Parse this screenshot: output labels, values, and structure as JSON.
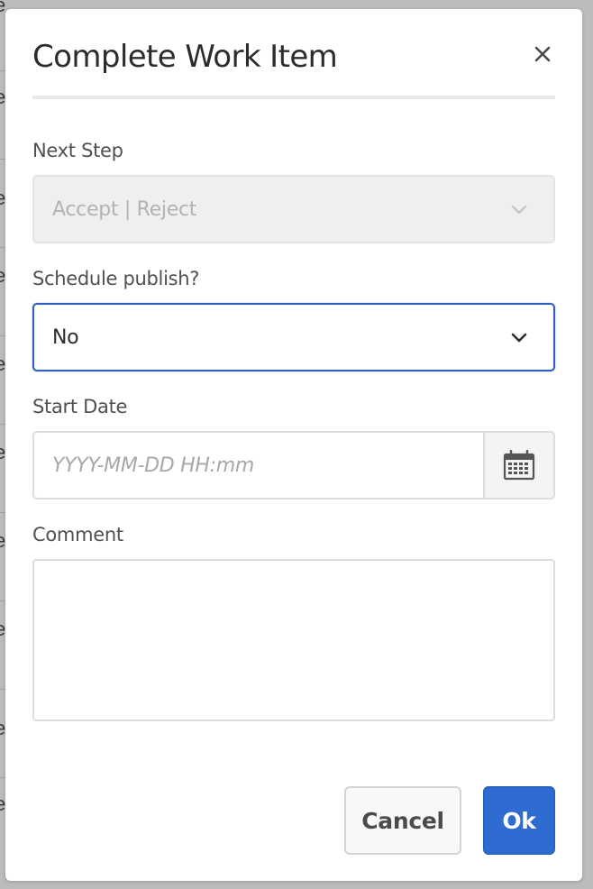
{
  "dialog": {
    "title": "Complete Work Item",
    "close_icon": "close-icon"
  },
  "fields": {
    "next_step": {
      "label": "Next Step",
      "value": "Accept | Reject",
      "disabled": true
    },
    "schedule_publish": {
      "label": "Schedule publish?",
      "value": "No"
    },
    "start_date": {
      "label": "Start Date",
      "placeholder": "YYYY-MM-DD HH:mm",
      "value": "",
      "icon": "calendar-icon"
    },
    "comment": {
      "label": "Comment",
      "value": ""
    }
  },
  "footer": {
    "cancel_label": "Cancel",
    "ok_label": "Ok"
  },
  "colors": {
    "primary": "#2e6cd1",
    "focus_border": "#2f5fbf",
    "overlay": "#b5b5b5"
  }
}
